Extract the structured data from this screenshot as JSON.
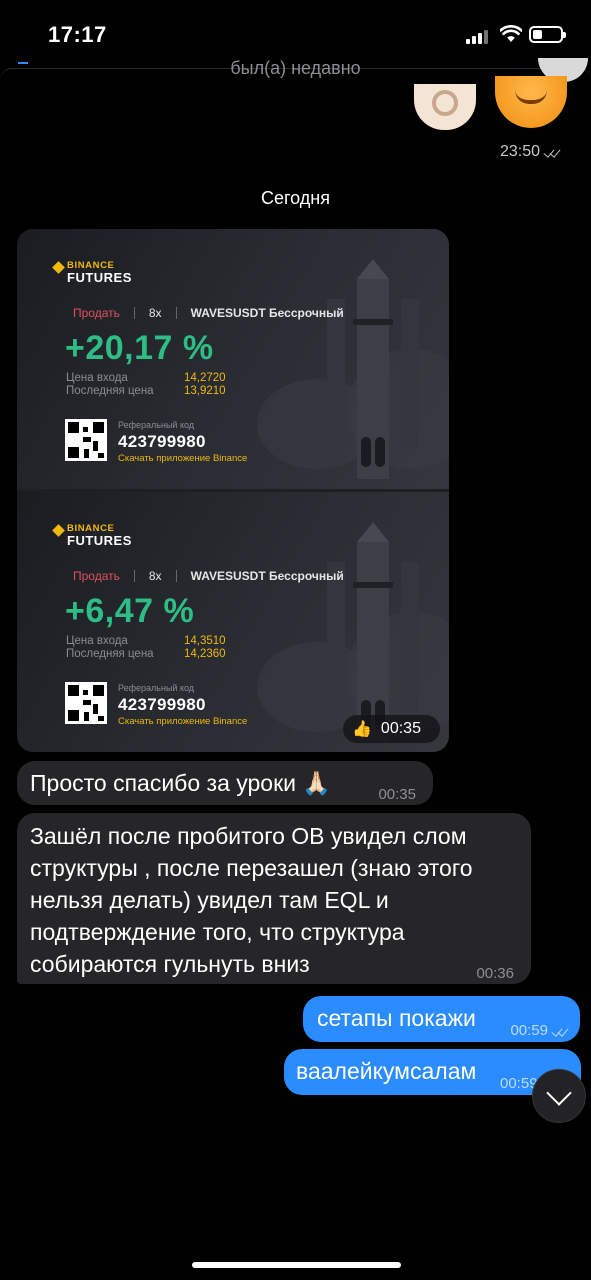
{
  "status_bar": {
    "time": "17:17",
    "battery_level": 0.3
  },
  "header": {
    "subtitle": "был(а) недавно"
  },
  "sticker_message": {
    "time": "23:50",
    "read": true
  },
  "date_separator": "Сегодня",
  "cards": [
    {
      "brand": "BINANCE",
      "product": "FUTURES",
      "side": "Продать",
      "leverage": "8x",
      "pair": "WAVESUSDT Бессрочный",
      "pnl": "+20,17 %",
      "entry_label": "Цена входа",
      "entry_price": "14,2720",
      "last_label": "Последняя цена",
      "last_price": "13,9210",
      "ref_label": "Реферальный код",
      "ref_code": "423799980",
      "ref_app": "Скачать приложение Binance"
    },
    {
      "brand": "BINANCE",
      "product": "FUTURES",
      "side": "Продать",
      "leverage": "8x",
      "pair": "WAVESUSDT Бессрочный",
      "pnl": "+6,47 %",
      "entry_label": "Цена входа",
      "entry_price": "14,3510",
      "last_label": "Последняя цена",
      "last_price": "14,2360",
      "ref_label": "Реферальный код",
      "ref_code": "423799980",
      "ref_app": "Скачать приложение Binance"
    }
  ],
  "album": {
    "reaction": "👍",
    "time": "00:35"
  },
  "messages": [
    {
      "direction": "in",
      "text": "Просто спасибо за уроки 🙏🏻",
      "time": "00:35"
    },
    {
      "direction": "in",
      "text": "Зашёл после пробитого OB увидел слом структуры , после перезашел (знаю этого нельзя делать) увидел там EQL и подтверждение того, что структура собираются гульнуть вниз",
      "time": "00:36"
    },
    {
      "direction": "out",
      "text": "сетапы покажи",
      "time": "00:59",
      "read": true
    },
    {
      "direction": "out",
      "text": "ваалейкумсалам",
      "time": "00:59"
    }
  ],
  "colors": {
    "accent_blue": "#2b8cff",
    "binance_yellow": "#f0b90b",
    "profit_green": "#2ebd85",
    "sell_red": "#e0505f"
  },
  "icons": [
    "signal-icon",
    "wifi-icon",
    "battery-icon",
    "back-icon",
    "double-check-icon",
    "chevron-down-icon"
  ]
}
